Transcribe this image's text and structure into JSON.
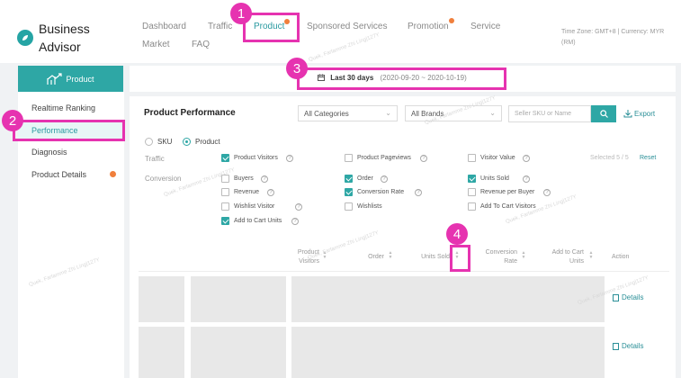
{
  "header": {
    "brand_line1": "Business",
    "brand_line2": "Advisor",
    "nav": [
      {
        "label": "Dashboard"
      },
      {
        "label": "Traffic"
      },
      {
        "label": "Product"
      },
      {
        "label": "Sponsored Services"
      },
      {
        "label": "Promotion"
      },
      {
        "label": "Service"
      },
      {
        "label": "Market"
      },
      {
        "label": "FAQ"
      }
    ],
    "timezone_line1": "Time Zone: GMT+8 | Currency: MYR",
    "timezone_line2": "(RM)"
  },
  "sidebar": {
    "header": "Product",
    "items": [
      {
        "label": "Realtime Ranking"
      },
      {
        "label": "Performance"
      },
      {
        "label": "Diagnosis"
      },
      {
        "label": "Product Details"
      }
    ]
  },
  "datebar": {
    "label": "Last 30 days",
    "range": "(2020-09-20 ~ 2020-10-19)"
  },
  "panel": {
    "title": "Product Performance",
    "category_select": "All Categories",
    "brand_select": "All Brands",
    "search_placeholder": "Seller SKU or Name",
    "export_label": "Export",
    "radio_sku": "SKU",
    "radio_product": "Product",
    "traffic_label": "Traffic",
    "conversion_label": "Conversion",
    "selected_text": "Selected 5 / 5",
    "reset_label": "Reset",
    "metrics": [
      {
        "label": "Product Visitors",
        "checked": true
      },
      {
        "label": "Product Pageviews",
        "checked": false
      },
      {
        "label": "Visitor Value",
        "checked": false
      },
      {
        "label": "Buyers",
        "checked": false
      },
      {
        "label": "Order",
        "checked": true
      },
      {
        "label": "Units Sold",
        "checked": true
      },
      {
        "label": "Revenue",
        "checked": false
      },
      {
        "label": "Conversion Rate",
        "checked": true
      },
      {
        "label": "Revenue per Buyer",
        "checked": false
      },
      {
        "label": "Wishlist Visitor",
        "checked": false
      },
      {
        "label": "Wishlists",
        "checked": false
      },
      {
        "label": "Add To Cart Visitors",
        "checked": false
      },
      {
        "label": "Add to Cart Units",
        "checked": true
      }
    ],
    "columns": [
      {
        "line1": "Product",
        "line2": "Visitors"
      },
      {
        "line1": "Order",
        "line2": ""
      },
      {
        "line1": "Units Sold",
        "line2": ""
      },
      {
        "line1": "Conversion",
        "line2": "Rate"
      },
      {
        "line1": "Add to Cart",
        "line2": "Units"
      },
      {
        "line1": "Action",
        "line2": ""
      }
    ],
    "row_action": "Details"
  },
  "annotations": [
    "1",
    "2",
    "3",
    "4"
  ],
  "watermark": "Quek, Farlamme Zhi Ling|127Y",
  "colors": {
    "accent": "#2ea7a5",
    "annotation": "#e633b0",
    "notification_dot": "#f07f3c"
  }
}
